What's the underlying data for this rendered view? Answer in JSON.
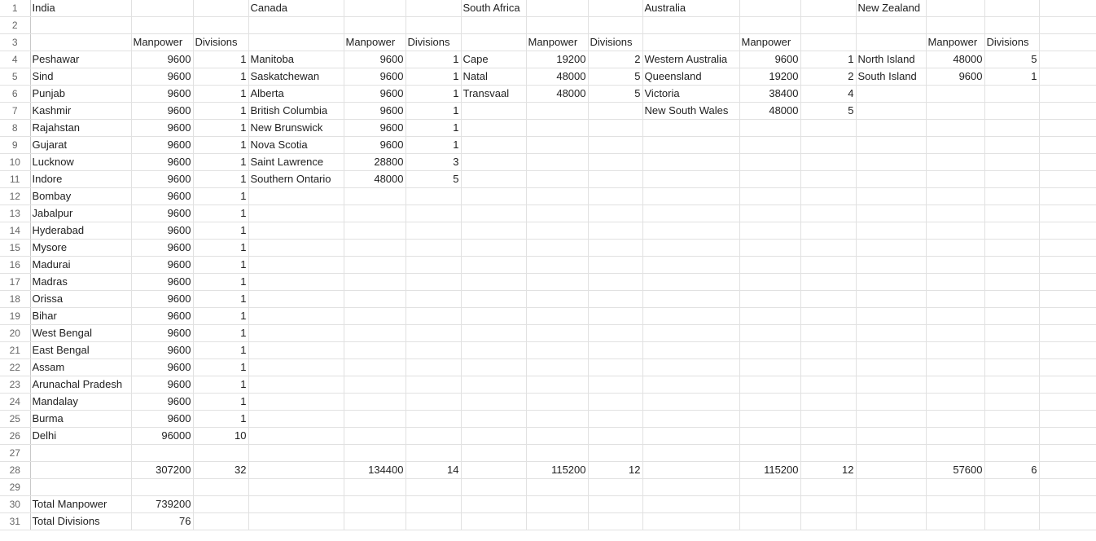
{
  "sheet": {
    "rows": [
      {
        "n": "1",
        "c": [
          "India",
          "",
          "",
          "Canada",
          "",
          "",
          "South Africa",
          "",
          "",
          "Australia",
          "",
          "",
          "New Zealand",
          "",
          ""
        ]
      },
      {
        "n": "2",
        "c": [
          "",
          "",
          "",
          "",
          "",
          "",
          "",
          "",
          "",
          "",
          "",
          "",
          "",
          "",
          ""
        ]
      },
      {
        "n": "3",
        "c": [
          "",
          "Manpower",
          "Divisions",
          "",
          "Manpower",
          "Divisions",
          "",
          "Manpower",
          "Divisions",
          "",
          "Manpower",
          "",
          "",
          "Manpower",
          "Divisions"
        ]
      },
      {
        "n": "4",
        "c": [
          "Peshawar",
          "9600",
          "1",
          "Manitoba",
          "9600",
          "1",
          "Cape",
          "19200",
          "2",
          "Western Australia",
          "9600",
          "1",
          "North Island",
          "48000",
          "5"
        ]
      },
      {
        "n": "5",
        "c": [
          "Sind",
          "9600",
          "1",
          "Saskatchewan",
          "9600",
          "1",
          "Natal",
          "48000",
          "5",
          "Queensland",
          "19200",
          "2",
          "South Island",
          "9600",
          "1"
        ]
      },
      {
        "n": "6",
        "c": [
          "Punjab",
          "9600",
          "1",
          "Alberta",
          "9600",
          "1",
          "Transvaal",
          "48000",
          "5",
          "Victoria",
          "38400",
          "4",
          "",
          "",
          ""
        ]
      },
      {
        "n": "7",
        "c": [
          "Kashmir",
          "9600",
          "1",
          "British Columbia",
          "9600",
          "1",
          "",
          "",
          "",
          "New South Wales",
          "48000",
          "5",
          "",
          "",
          ""
        ]
      },
      {
        "n": "8",
        "c": [
          "Rajahstan",
          "9600",
          "1",
          "New Brunswick",
          "9600",
          "1",
          "",
          "",
          "",
          "",
          "",
          "",
          "",
          "",
          ""
        ]
      },
      {
        "n": "9",
        "c": [
          "Gujarat",
          "9600",
          "1",
          "Nova Scotia",
          "9600",
          "1",
          "",
          "",
          "",
          "",
          "",
          "",
          "",
          "",
          ""
        ]
      },
      {
        "n": "10",
        "c": [
          "Lucknow",
          "9600",
          "1",
          "Saint Lawrence",
          "28800",
          "3",
          "",
          "",
          "",
          "",
          "",
          "",
          "",
          "",
          ""
        ]
      },
      {
        "n": "11",
        "c": [
          "Indore",
          "9600",
          "1",
          "Southern Ontario",
          "48000",
          "5",
          "",
          "",
          "",
          "",
          "",
          "",
          "",
          "",
          ""
        ]
      },
      {
        "n": "12",
        "c": [
          "Bombay",
          "9600",
          "1",
          "",
          "",
          "",
          "",
          "",
          "",
          "",
          "",
          "",
          "",
          "",
          ""
        ]
      },
      {
        "n": "13",
        "c": [
          "Jabalpur",
          "9600",
          "1",
          "",
          "",
          "",
          "",
          "",
          "",
          "",
          "",
          "",
          "",
          "",
          ""
        ]
      },
      {
        "n": "14",
        "c": [
          "Hyderabad",
          "9600",
          "1",
          "",
          "",
          "",
          "",
          "",
          "",
          "",
          "",
          "",
          "",
          "",
          ""
        ]
      },
      {
        "n": "15",
        "c": [
          "Mysore",
          "9600",
          "1",
          "",
          "",
          "",
          "",
          "",
          "",
          "",
          "",
          "",
          "",
          "",
          ""
        ]
      },
      {
        "n": "16",
        "c": [
          "Madurai",
          "9600",
          "1",
          "",
          "",
          "",
          "",
          "",
          "",
          "",
          "",
          "",
          "",
          "",
          ""
        ]
      },
      {
        "n": "17",
        "c": [
          "Madras",
          "9600",
          "1",
          "",
          "",
          "",
          "",
          "",
          "",
          "",
          "",
          "",
          "",
          "",
          ""
        ]
      },
      {
        "n": "18",
        "c": [
          "Orissa",
          "9600",
          "1",
          "",
          "",
          "",
          "",
          "",
          "",
          "",
          "",
          "",
          "",
          "",
          ""
        ]
      },
      {
        "n": "19",
        "c": [
          "Bihar",
          "9600",
          "1",
          "",
          "",
          "",
          "",
          "",
          "",
          "",
          "",
          "",
          "",
          "",
          ""
        ]
      },
      {
        "n": "20",
        "c": [
          "West Bengal",
          "9600",
          "1",
          "",
          "",
          "",
          "",
          "",
          "",
          "",
          "",
          "",
          "",
          "",
          ""
        ]
      },
      {
        "n": "21",
        "c": [
          "East Bengal",
          "9600",
          "1",
          "",
          "",
          "",
          "",
          "",
          "",
          "",
          "",
          "",
          "",
          "",
          ""
        ]
      },
      {
        "n": "22",
        "c": [
          "Assam",
          "9600",
          "1",
          "",
          "",
          "",
          "",
          "",
          "",
          "",
          "",
          "",
          "",
          "",
          ""
        ]
      },
      {
        "n": "23",
        "c": [
          "Arunachal Pradesh",
          "9600",
          "1",
          "",
          "",
          "",
          "",
          "",
          "",
          "",
          "",
          "",
          "",
          "",
          ""
        ]
      },
      {
        "n": "24",
        "c": [
          "Mandalay",
          "9600",
          "1",
          "",
          "",
          "",
          "",
          "",
          "",
          "",
          "",
          "",
          "",
          "",
          ""
        ]
      },
      {
        "n": "25",
        "c": [
          "Burma",
          "9600",
          "1",
          "",
          "",
          "",
          "",
          "",
          "",
          "",
          "",
          "",
          "",
          "",
          ""
        ]
      },
      {
        "n": "26",
        "c": [
          "Delhi",
          "96000",
          "10",
          "",
          "",
          "",
          "",
          "",
          "",
          "",
          "",
          "",
          "",
          "",
          ""
        ]
      },
      {
        "n": "27",
        "c": [
          "",
          "",
          "",
          "",
          "",
          "",
          "",
          "",
          "",
          "",
          "",
          "",
          "",
          "",
          ""
        ]
      },
      {
        "n": "28",
        "c": [
          "",
          "307200",
          "32",
          "",
          "134400",
          "14",
          "",
          "115200",
          "12",
          "",
          "115200",
          "12",
          "",
          "57600",
          "6"
        ]
      },
      {
        "n": "29",
        "c": [
          "",
          "",
          "",
          "",
          "",
          "",
          "",
          "",
          "",
          "",
          "",
          "",
          "",
          "",
          ""
        ]
      },
      {
        "n": "30",
        "c": [
          "Total Manpower",
          "739200",
          "",
          "",
          "",
          "",
          "",
          "",
          "",
          "",
          "",
          "",
          "",
          "",
          ""
        ]
      },
      {
        "n": "31",
        "c": [
          "Total Divisions",
          "76",
          "",
          "",
          "",
          "",
          "",
          "",
          "",
          "",
          "",
          "",
          "",
          "",
          ""
        ]
      }
    ]
  }
}
